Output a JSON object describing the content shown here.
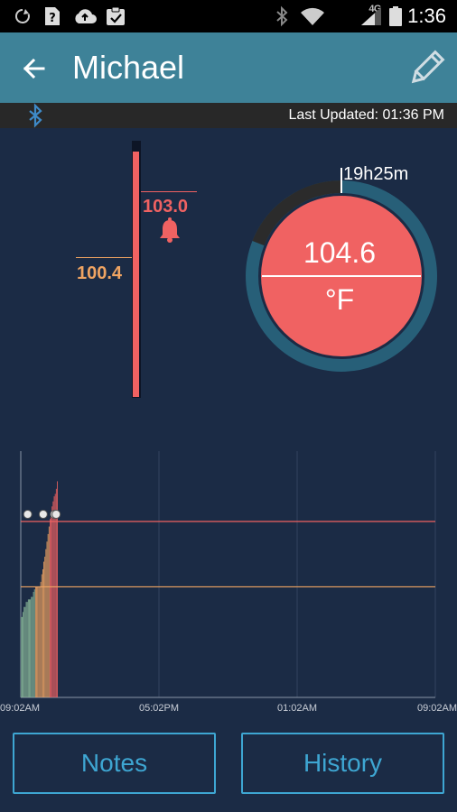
{
  "status_bar": {
    "time": "1:36",
    "network": "4G",
    "icons": [
      "sync-icon",
      "sim-unknown-icon",
      "cloud-upload-icon",
      "clipboard-check-icon",
      "bluetooth-icon",
      "wifi-icon",
      "signal-icon",
      "battery-icon"
    ]
  },
  "app_bar": {
    "title": "Michael",
    "back_icon": "arrow-back-icon",
    "edit_icon": "pencil-icon"
  },
  "info_bar": {
    "last_updated": "Last Updated: 01:36 PM",
    "bluetooth_icon": "bluetooth-icon"
  },
  "thermometer": {
    "alarm_threshold": "103.0",
    "alert_threshold": "100.4",
    "current_fill_fraction": 0.96,
    "alarm_color": "#f06262",
    "alert_color": "#f0a462"
  },
  "gauge": {
    "elapsed": "19h25m",
    "reading": "104.6",
    "unit": "°F",
    "progress_fraction": 0.81,
    "ring_color": "#275f78",
    "remaining_color": "#2b2b2b",
    "fill_color": "#f06262"
  },
  "chart_data": {
    "type": "bar",
    "x_ticks": [
      "09:02AM",
      "05:02PM",
      "01:02AM",
      "09:02AM"
    ],
    "x_range_hours": [
      0,
      24
    ],
    "y_range": [
      96.0,
      105.8
    ],
    "threshold_lines": [
      {
        "value": 103.0,
        "color": "#f06262"
      },
      {
        "value": 100.4,
        "color": "#f0a462"
      }
    ],
    "color_bands": [
      {
        "below": 99.0,
        "color": "#6fcfa6"
      },
      {
        "below": 100.4,
        "color": "#8bb99a"
      },
      {
        "below": 103.0,
        "color": "#f0a462"
      },
      {
        "below": 200,
        "color": "#f06262"
      }
    ],
    "bars": [
      {
        "t": 0.02,
        "v": 99.2
      },
      {
        "t": 0.08,
        "v": 99.2
      },
      {
        "t": 0.14,
        "v": 99.4
      },
      {
        "t": 0.2,
        "v": 99.6
      },
      {
        "t": 0.26,
        "v": 99.6
      },
      {
        "t": 0.32,
        "v": 99.8
      },
      {
        "t": 0.38,
        "v": 99.8
      },
      {
        "t": 0.44,
        "v": 99.9
      },
      {
        "t": 0.5,
        "v": 99.9
      },
      {
        "t": 0.56,
        "v": 99.9
      },
      {
        "t": 0.62,
        "v": 100.0
      },
      {
        "t": 0.68,
        "v": 100.0
      },
      {
        "t": 0.74,
        "v": 100.2
      },
      {
        "t": 0.8,
        "v": 100.3
      },
      {
        "t": 0.86,
        "v": 100.4
      },
      {
        "t": 0.92,
        "v": 100.4
      },
      {
        "t": 0.98,
        "v": 100.4
      },
      {
        "t": 1.04,
        "v": 100.4
      },
      {
        "t": 1.1,
        "v": 100.4
      },
      {
        "t": 1.16,
        "v": 100.6
      },
      {
        "t": 1.22,
        "v": 100.9
      },
      {
        "t": 1.28,
        "v": 101.1
      },
      {
        "t": 1.34,
        "v": 101.4
      },
      {
        "t": 1.4,
        "v": 101.6
      },
      {
        "t": 1.46,
        "v": 101.9
      },
      {
        "t": 1.52,
        "v": 102.2
      },
      {
        "t": 1.58,
        "v": 102.5
      },
      {
        "t": 1.64,
        "v": 102.8
      },
      {
        "t": 1.7,
        "v": 103.1
      },
      {
        "t": 1.76,
        "v": 103.4
      },
      {
        "t": 1.82,
        "v": 103.6
      },
      {
        "t": 1.88,
        "v": 103.8
      },
      {
        "t": 1.94,
        "v": 104.0
      },
      {
        "t": 2.0,
        "v": 104.1
      },
      {
        "t": 2.06,
        "v": 104.3
      },
      {
        "t": 2.12,
        "v": 104.6
      }
    ],
    "note_markers": [
      0.4,
      1.3,
      1.95,
      2.05
    ]
  },
  "buttons": {
    "notes": "Notes",
    "history": "History"
  }
}
